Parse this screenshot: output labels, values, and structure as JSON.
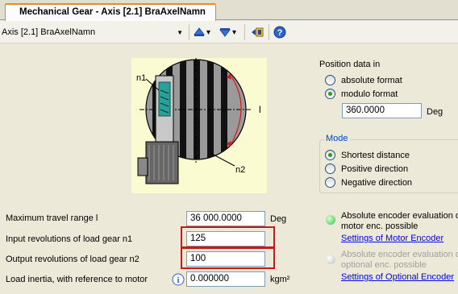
{
  "tab": {
    "title": "Mechanical Gear - Axis [2.1] BraAxelNamn"
  },
  "toolbar": {
    "axis_select": "Axis [2.1] BraAxelNamn"
  },
  "image": {
    "n1_label": "n1",
    "n2_label": "n2",
    "l_label": "l"
  },
  "fields": {
    "max_travel": {
      "label": "Maximum travel range l",
      "value": "36 000.0000",
      "unit": "Deg"
    },
    "input_rev": {
      "label": "Input revolutions of load gear n1",
      "value": "125"
    },
    "output_rev": {
      "label": "Output revolutions of load gear n2",
      "value": "100"
    },
    "load_inertia": {
      "label": "Load inertia, with reference to motor",
      "value": "0.000000",
      "unit": "kgm²"
    }
  },
  "position": {
    "title": "Position data in",
    "absolute": "absolute format",
    "modulo": "modulo format",
    "modulo_value": "360.0000",
    "unit": "Deg"
  },
  "mode": {
    "title": "Mode",
    "shortest": "Shortest distance",
    "positive": "Positive direction",
    "negative": "Negative direction"
  },
  "encoder": {
    "motor_line1": "Absolute encoder evaluation of",
    "motor_line2": "motor enc. possible",
    "motor_link": "Settings of Motor Encoder",
    "optional_line1": "Absolute encoder evaluation of",
    "optional_line2": "optional enc. possible",
    "optional_link": "Settings of Optional Encoder",
    "motor_led_color": "#3fbf3f",
    "optional_led_color": "#c0c0c0"
  }
}
